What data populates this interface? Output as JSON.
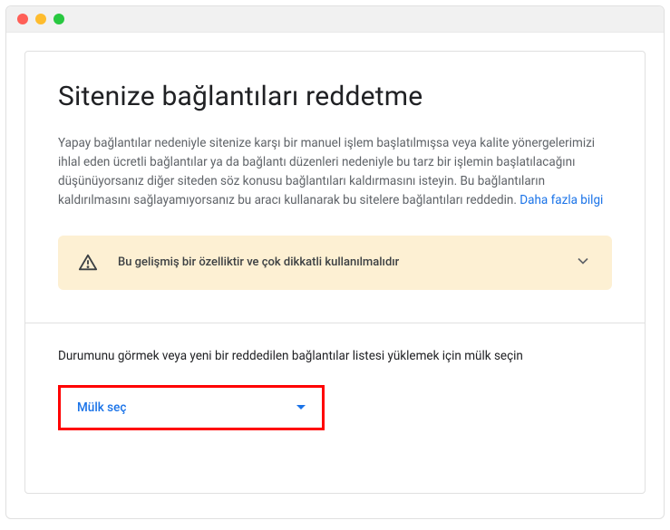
{
  "page": {
    "title": "Sitenize bağlantıları reddetme",
    "description": "Yapay bağlantılar nedeniyle sitenize karşı bir manuel işlem başlatılmışsa veya kalite yönergelerimizi ihlal eden ücretli bağlantılar ya da bağlantı düzenleri nedeniyle bu tarz bir işlemin başlatılacağını düşünüyorsanız diğer siteden söz konusu bağlantıları kaldırmasını isteyin. Bu bağlantıların kaldırılmasını sağlayamıyorsanız bu aracı kullanarak bu sitelere bağlantıları reddedin. ",
    "learn_more_label": "Daha fazla bilgi"
  },
  "warning": {
    "text": "Bu gelişmiş bir özelliktir ve çok dikkatli kullanılmalıdır"
  },
  "selector": {
    "label": "Durumunu görmek veya yeni bir reddedilen bağlantılar listesi yüklemek için mülk seçin",
    "button_label": "Mülk seç"
  }
}
